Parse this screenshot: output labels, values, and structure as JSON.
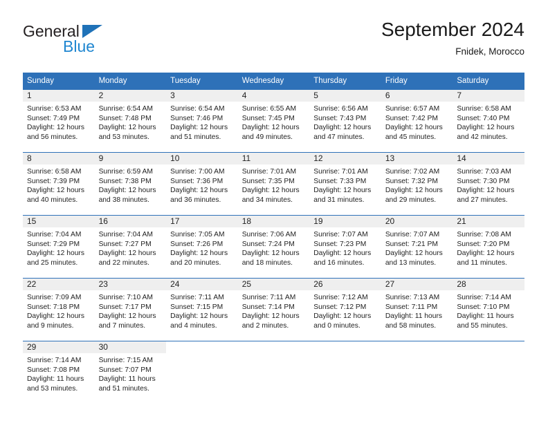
{
  "brand": {
    "name_top": "General",
    "name_bottom": "Blue",
    "triangle_color": "#1f72b8",
    "text_color_top": "#231f20",
    "text_color_bottom": "#1f86d0"
  },
  "header": {
    "title": "September 2024",
    "subtitle": "Fnidek, Morocco"
  },
  "theme": {
    "header_bg": "#2e71b8",
    "header_text": "#ffffff",
    "daynum_band_bg": "#efefef",
    "cell_bg": "#ffffff",
    "row_separator": "#2e71b8",
    "body_text": "#222222"
  },
  "calendar": {
    "weekday_headers": [
      "Sunday",
      "Monday",
      "Tuesday",
      "Wednesday",
      "Thursday",
      "Friday",
      "Saturday"
    ],
    "weeks": [
      [
        {
          "day": "1",
          "sunrise": "Sunrise: 6:53 AM",
          "sunset": "Sunset: 7:49 PM",
          "daylight_1": "Daylight: 12 hours",
          "daylight_2": "and 56 minutes."
        },
        {
          "day": "2",
          "sunrise": "Sunrise: 6:54 AM",
          "sunset": "Sunset: 7:48 PM",
          "daylight_1": "Daylight: 12 hours",
          "daylight_2": "and 53 minutes."
        },
        {
          "day": "3",
          "sunrise": "Sunrise: 6:54 AM",
          "sunset": "Sunset: 7:46 PM",
          "daylight_1": "Daylight: 12 hours",
          "daylight_2": "and 51 minutes."
        },
        {
          "day": "4",
          "sunrise": "Sunrise: 6:55 AM",
          "sunset": "Sunset: 7:45 PM",
          "daylight_1": "Daylight: 12 hours",
          "daylight_2": "and 49 minutes."
        },
        {
          "day": "5",
          "sunrise": "Sunrise: 6:56 AM",
          "sunset": "Sunset: 7:43 PM",
          "daylight_1": "Daylight: 12 hours",
          "daylight_2": "and 47 minutes."
        },
        {
          "day": "6",
          "sunrise": "Sunrise: 6:57 AM",
          "sunset": "Sunset: 7:42 PM",
          "daylight_1": "Daylight: 12 hours",
          "daylight_2": "and 45 minutes."
        },
        {
          "day": "7",
          "sunrise": "Sunrise: 6:58 AM",
          "sunset": "Sunset: 7:40 PM",
          "daylight_1": "Daylight: 12 hours",
          "daylight_2": "and 42 minutes."
        }
      ],
      [
        {
          "day": "8",
          "sunrise": "Sunrise: 6:58 AM",
          "sunset": "Sunset: 7:39 PM",
          "daylight_1": "Daylight: 12 hours",
          "daylight_2": "and 40 minutes."
        },
        {
          "day": "9",
          "sunrise": "Sunrise: 6:59 AM",
          "sunset": "Sunset: 7:38 PM",
          "daylight_1": "Daylight: 12 hours",
          "daylight_2": "and 38 minutes."
        },
        {
          "day": "10",
          "sunrise": "Sunrise: 7:00 AM",
          "sunset": "Sunset: 7:36 PM",
          "daylight_1": "Daylight: 12 hours",
          "daylight_2": "and 36 minutes."
        },
        {
          "day": "11",
          "sunrise": "Sunrise: 7:01 AM",
          "sunset": "Sunset: 7:35 PM",
          "daylight_1": "Daylight: 12 hours",
          "daylight_2": "and 34 minutes."
        },
        {
          "day": "12",
          "sunrise": "Sunrise: 7:01 AM",
          "sunset": "Sunset: 7:33 PM",
          "daylight_1": "Daylight: 12 hours",
          "daylight_2": "and 31 minutes."
        },
        {
          "day": "13",
          "sunrise": "Sunrise: 7:02 AM",
          "sunset": "Sunset: 7:32 PM",
          "daylight_1": "Daylight: 12 hours",
          "daylight_2": "and 29 minutes."
        },
        {
          "day": "14",
          "sunrise": "Sunrise: 7:03 AM",
          "sunset": "Sunset: 7:30 PM",
          "daylight_1": "Daylight: 12 hours",
          "daylight_2": "and 27 minutes."
        }
      ],
      [
        {
          "day": "15",
          "sunrise": "Sunrise: 7:04 AM",
          "sunset": "Sunset: 7:29 PM",
          "daylight_1": "Daylight: 12 hours",
          "daylight_2": "and 25 minutes."
        },
        {
          "day": "16",
          "sunrise": "Sunrise: 7:04 AM",
          "sunset": "Sunset: 7:27 PM",
          "daylight_1": "Daylight: 12 hours",
          "daylight_2": "and 22 minutes."
        },
        {
          "day": "17",
          "sunrise": "Sunrise: 7:05 AM",
          "sunset": "Sunset: 7:26 PM",
          "daylight_1": "Daylight: 12 hours",
          "daylight_2": "and 20 minutes."
        },
        {
          "day": "18",
          "sunrise": "Sunrise: 7:06 AM",
          "sunset": "Sunset: 7:24 PM",
          "daylight_1": "Daylight: 12 hours",
          "daylight_2": "and 18 minutes."
        },
        {
          "day": "19",
          "sunrise": "Sunrise: 7:07 AM",
          "sunset": "Sunset: 7:23 PM",
          "daylight_1": "Daylight: 12 hours",
          "daylight_2": "and 16 minutes."
        },
        {
          "day": "20",
          "sunrise": "Sunrise: 7:07 AM",
          "sunset": "Sunset: 7:21 PM",
          "daylight_1": "Daylight: 12 hours",
          "daylight_2": "and 13 minutes."
        },
        {
          "day": "21",
          "sunrise": "Sunrise: 7:08 AM",
          "sunset": "Sunset: 7:20 PM",
          "daylight_1": "Daylight: 12 hours",
          "daylight_2": "and 11 minutes."
        }
      ],
      [
        {
          "day": "22",
          "sunrise": "Sunrise: 7:09 AM",
          "sunset": "Sunset: 7:18 PM",
          "daylight_1": "Daylight: 12 hours",
          "daylight_2": "and 9 minutes."
        },
        {
          "day": "23",
          "sunrise": "Sunrise: 7:10 AM",
          "sunset": "Sunset: 7:17 PM",
          "daylight_1": "Daylight: 12 hours",
          "daylight_2": "and 7 minutes."
        },
        {
          "day": "24",
          "sunrise": "Sunrise: 7:11 AM",
          "sunset": "Sunset: 7:15 PM",
          "daylight_1": "Daylight: 12 hours",
          "daylight_2": "and 4 minutes."
        },
        {
          "day": "25",
          "sunrise": "Sunrise: 7:11 AM",
          "sunset": "Sunset: 7:14 PM",
          "daylight_1": "Daylight: 12 hours",
          "daylight_2": "and 2 minutes."
        },
        {
          "day": "26",
          "sunrise": "Sunrise: 7:12 AM",
          "sunset": "Sunset: 7:12 PM",
          "daylight_1": "Daylight: 12 hours",
          "daylight_2": "and 0 minutes."
        },
        {
          "day": "27",
          "sunrise": "Sunrise: 7:13 AM",
          "sunset": "Sunset: 7:11 PM",
          "daylight_1": "Daylight: 11 hours",
          "daylight_2": "and 58 minutes."
        },
        {
          "day": "28",
          "sunrise": "Sunrise: 7:14 AM",
          "sunset": "Sunset: 7:10 PM",
          "daylight_1": "Daylight: 11 hours",
          "daylight_2": "and 55 minutes."
        }
      ],
      [
        {
          "day": "29",
          "sunrise": "Sunrise: 7:14 AM",
          "sunset": "Sunset: 7:08 PM",
          "daylight_1": "Daylight: 11 hours",
          "daylight_2": "and 53 minutes."
        },
        {
          "day": "30",
          "sunrise": "Sunrise: 7:15 AM",
          "sunset": "Sunset: 7:07 PM",
          "daylight_1": "Daylight: 11 hours",
          "daylight_2": "and 51 minutes."
        },
        {
          "day": "",
          "sunrise": "",
          "sunset": "",
          "daylight_1": "",
          "daylight_2": ""
        },
        {
          "day": "",
          "sunrise": "",
          "sunset": "",
          "daylight_1": "",
          "daylight_2": ""
        },
        {
          "day": "",
          "sunrise": "",
          "sunset": "",
          "daylight_1": "",
          "daylight_2": ""
        },
        {
          "day": "",
          "sunrise": "",
          "sunset": "",
          "daylight_1": "",
          "daylight_2": ""
        },
        {
          "day": "",
          "sunrise": "",
          "sunset": "",
          "daylight_1": "",
          "daylight_2": ""
        }
      ]
    ]
  }
}
